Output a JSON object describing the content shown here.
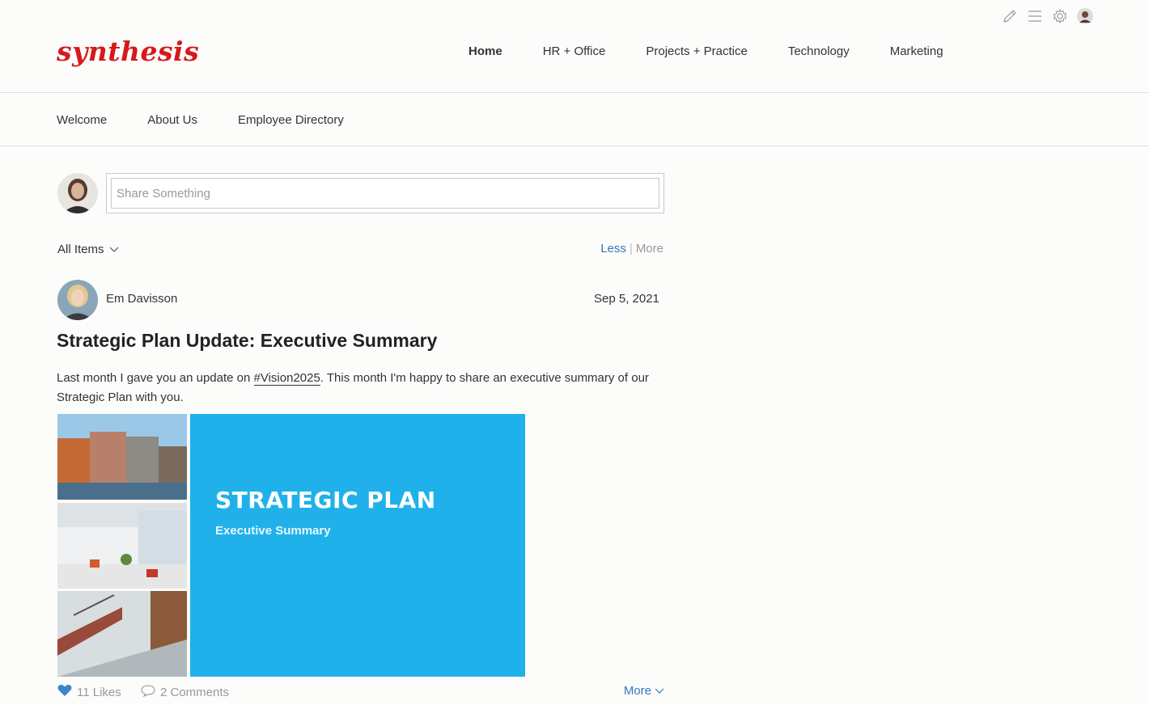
{
  "header": {
    "logo": "synthesis",
    "nav": [
      {
        "label": "Home",
        "active": true
      },
      {
        "label": "HR + Office"
      },
      {
        "label": "Projects + Practice"
      },
      {
        "label": "Technology"
      },
      {
        "label": "Marketing"
      }
    ],
    "icons": [
      "pencil-icon",
      "menu-icon",
      "gear-icon",
      "user-avatar"
    ]
  },
  "subnav": [
    "Welcome",
    "About Us",
    "Employee Directory"
  ],
  "share": {
    "placeholder": "Share Something"
  },
  "filter": {
    "label": "All Items"
  },
  "view_toggle": {
    "less": "Less",
    "separator": "|",
    "more": "More"
  },
  "post": {
    "author": "Em Davisson",
    "date": "Sep 5, 2021",
    "title": "Strategic Plan Update: Executive Summary",
    "body_before": "Last month I gave you an update on ",
    "hashtag": "#Vision2025",
    "body_after": ". This month I'm happy to share an executive summary of our Strategic Plan with you.",
    "image": {
      "title": "STRATEGIC PLAN",
      "subtitle": "Executive Summary"
    },
    "likes": "11 Likes",
    "comments": "2 Comments",
    "more": "More"
  },
  "colors": {
    "brand": "#d7191c",
    "link": "#2f7ab8",
    "image_blue": "#20b1eb"
  }
}
